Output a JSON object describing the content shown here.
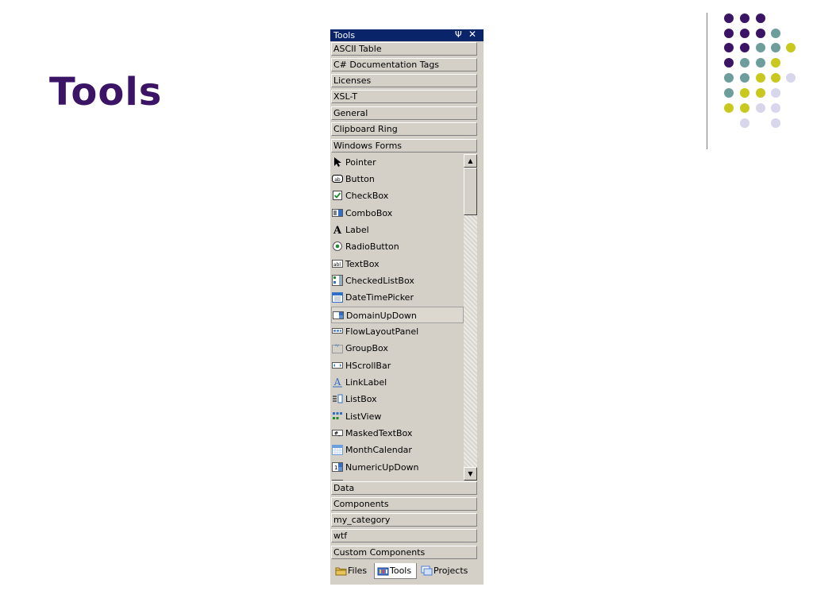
{
  "slide": {
    "title": "Tools"
  },
  "panel": {
    "title": "Tools",
    "pin_glyph": "Ψ",
    "close_glyph": "✕",
    "top_tabs": [
      "ASCII Table",
      "C# Documentation Tags",
      "Licenses",
      "XSL-T",
      "General",
      "Clipboard Ring",
      "Windows Forms"
    ],
    "items": [
      {
        "label": "Pointer",
        "icon": "pointer-icon"
      },
      {
        "label": "Button",
        "icon": "button-icon"
      },
      {
        "label": "CheckBox",
        "icon": "checkbox-icon"
      },
      {
        "label": "ComboBox",
        "icon": "combobox-icon"
      },
      {
        "label": "Label",
        "icon": "label-icon"
      },
      {
        "label": "RadioButton",
        "icon": "radiobutton-icon"
      },
      {
        "label": "TextBox",
        "icon": "textbox-icon"
      },
      {
        "label": "CheckedListBox",
        "icon": "checkedlistbox-icon"
      },
      {
        "label": "DateTimePicker",
        "icon": "datetimepicker-icon"
      },
      {
        "label": "DomainUpDown",
        "icon": "domainupdown-icon"
      },
      {
        "label": "FlowLayoutPanel",
        "icon": "flowlayoutpanel-icon"
      },
      {
        "label": "GroupBox",
        "icon": "groupbox-icon"
      },
      {
        "label": "HScrollBar",
        "icon": "hscrollbar-icon"
      },
      {
        "label": "LinkLabel",
        "icon": "linklabel-icon"
      },
      {
        "label": "ListBox",
        "icon": "listbox-icon"
      },
      {
        "label": "ListView",
        "icon": "listview-icon"
      },
      {
        "label": "MaskedTextBox",
        "icon": "maskedtextbox-icon"
      },
      {
        "label": "MonthCalendar",
        "icon": "monthcalendar-icon"
      },
      {
        "label": "NumericUpDown",
        "icon": "numericupdown-icon"
      }
    ],
    "selected_item": "DomainUpDown",
    "bottom_category_tabs": [
      "Data",
      "Components",
      "my_category",
      "wtf",
      "Custom Components"
    ],
    "footer_tabs": [
      {
        "label": "Files",
        "icon": "folder-icon",
        "active": false
      },
      {
        "label": "Tools",
        "icon": "toolbox-icon",
        "active": true
      },
      {
        "label": "Projects",
        "icon": "projects-icon",
        "active": false
      }
    ]
  },
  "colors": {
    "title": "#3b1466",
    "dot_purple": "#3b1466",
    "dot_teal": "#6e9e9c",
    "dot_yellow": "#c8c81e",
    "dot_lavender": "#d8d6ea",
    "titlebar": "#0a246a",
    "panel_bg": "#d4d0c8"
  }
}
